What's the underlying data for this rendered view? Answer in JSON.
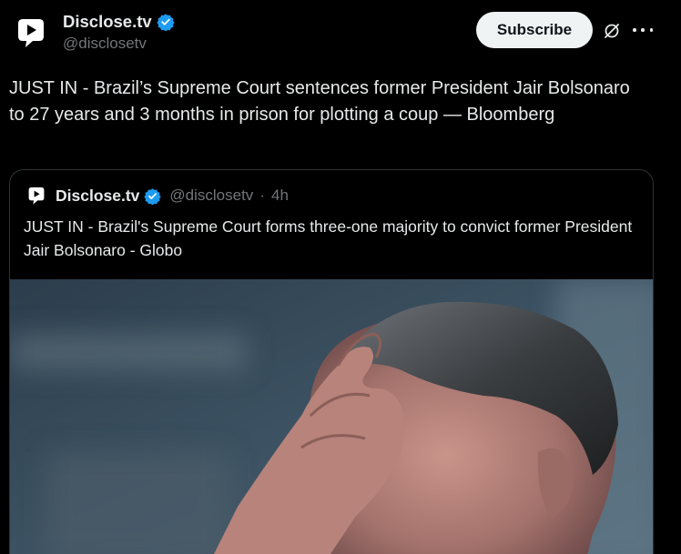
{
  "author": {
    "display_name": "Disclose.tv",
    "handle": "@disclosetv"
  },
  "actions": {
    "subscribe_label": "Subscribe",
    "grok_icon": "grok-icon",
    "more_icon": "more-icon"
  },
  "post": {
    "text": "JUST IN - Brazil’s Supreme Court sentences former President Jair Bolsonaro to 27 years and 3 months in prison for plotting a coup — Bloomberg"
  },
  "quote": {
    "display_name": "Disclose.tv",
    "handle": "@disclosetv",
    "separator": "·",
    "time": "4h",
    "text": "JUST IN - Brazil's Supreme Court forms three-one majority to convict former President Jair Bolsonaro - Globo"
  },
  "colors": {
    "background": "#000000",
    "text_primary": "#e7e9ea",
    "text_secondary": "#71767b",
    "verified_badge": "#1d9bf0",
    "subscribe_bg": "#eff3f4",
    "border": "#2f3336"
  }
}
